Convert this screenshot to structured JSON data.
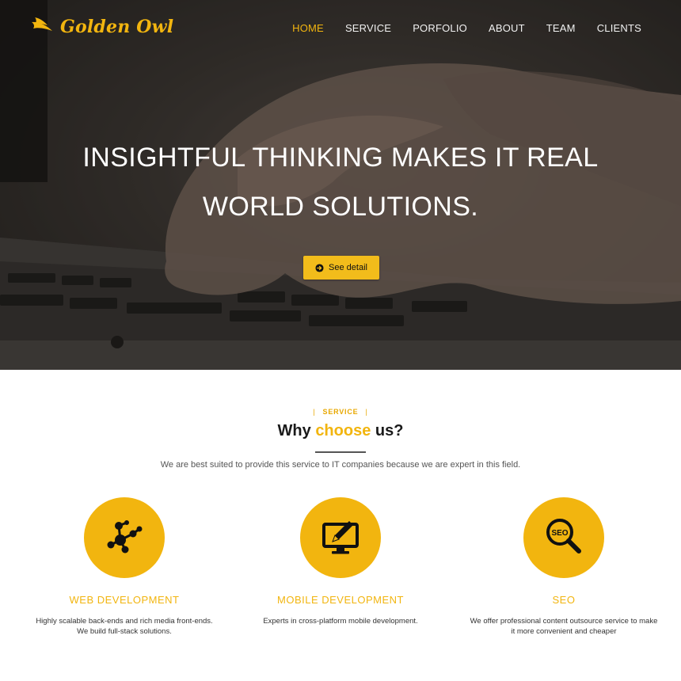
{
  "brand": {
    "name": "Golden Owl",
    "accent_color": "#f2b50f"
  },
  "nav": {
    "items": [
      {
        "label": "HOME",
        "active": true
      },
      {
        "label": "SERVICE",
        "active": false
      },
      {
        "label": "PORFOLIO",
        "active": false
      },
      {
        "label": "ABOUT",
        "active": false
      },
      {
        "label": "TEAM",
        "active": false
      },
      {
        "label": "CLIENTS",
        "active": false
      }
    ]
  },
  "hero": {
    "title_line1": "INSIGHTFUL THINKING MAKES IT REAL",
    "title_line2": "WORLD SOLUTIONS.",
    "cta_label": "See detail",
    "cta_icon": "circle-arrow-right-icon",
    "background_image": "hands-on-laptop-keyboard"
  },
  "service": {
    "eyebrow": "SERVICE",
    "title_prefix": "Why ",
    "title_accent": "choose",
    "title_suffix": " us?",
    "subtitle": "We are best suited to provide this service to IT companies because we are expert in this field.",
    "cards": [
      {
        "icon": "network-nodes-icon",
        "title": "WEB DEVELOPMENT",
        "description": "Highly scalable back-ends and rich media front-ends.\nWe build full-stack solutions."
      },
      {
        "icon": "monitor-pen-icon",
        "title": "MOBILE DEVELOPMENT",
        "description": "Experts in cross-platform mobile development."
      },
      {
        "icon": "seo-magnifier-icon",
        "title": "SEO",
        "description": "We offer professional content outsource service to make\nit more convenient and cheaper"
      }
    ]
  }
}
